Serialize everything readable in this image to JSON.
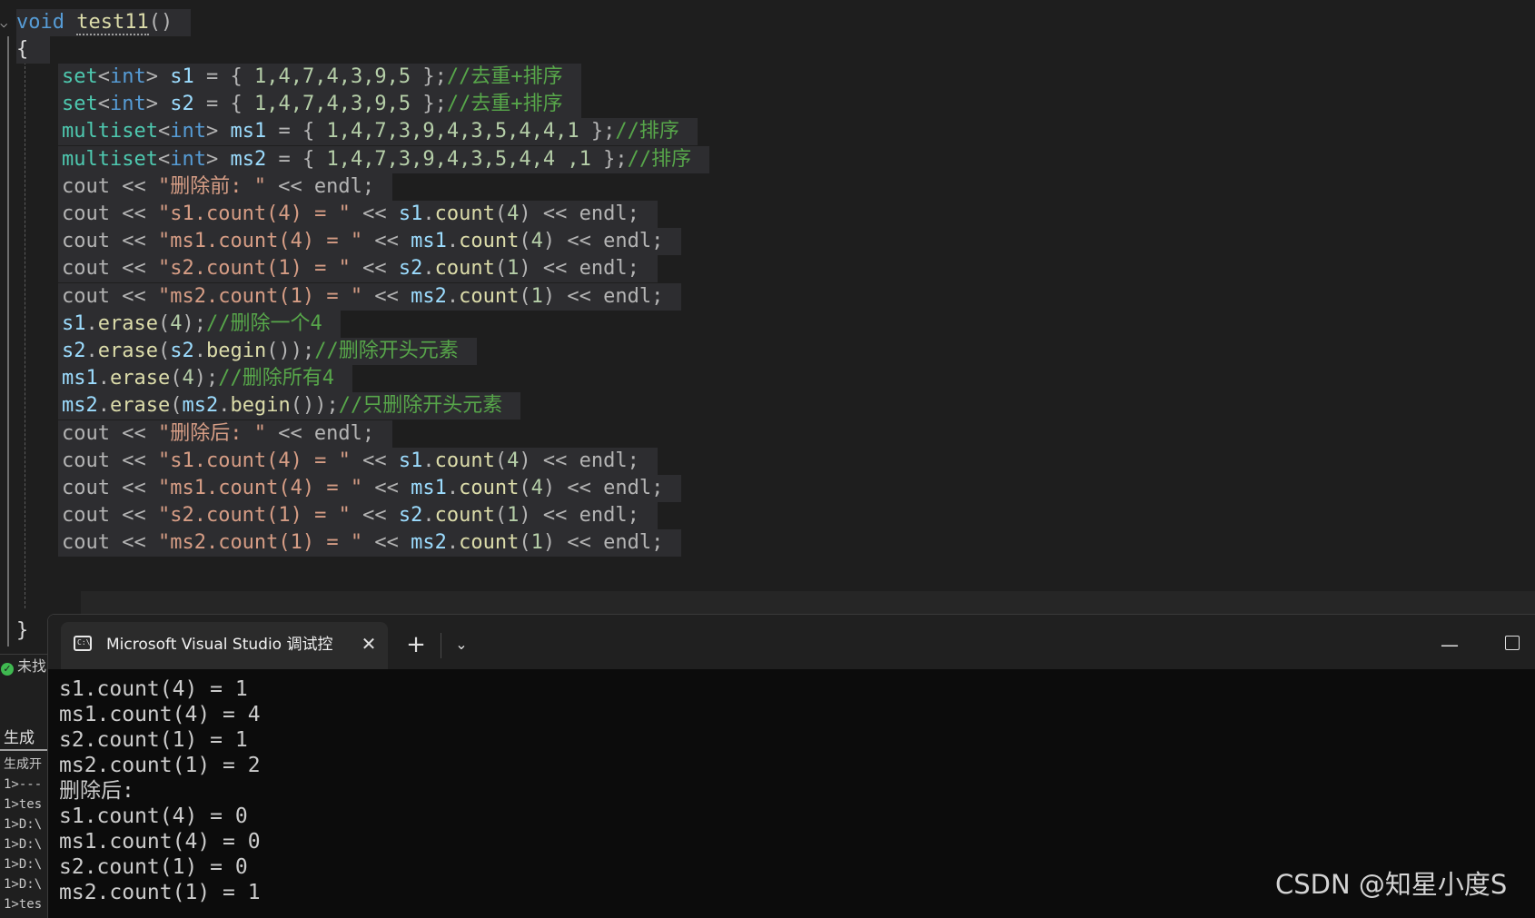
{
  "editor": {
    "signature": {
      "kw": "void",
      "name": "test11",
      "parens": "()"
    },
    "open_brace": "{",
    "close_brace": "}",
    "lines": [
      {
        "tokens": [
          [
            "type",
            "set"
          ],
          [
            "op",
            "<"
          ],
          [
            "kw",
            "int"
          ],
          [
            "op",
            "> "
          ],
          [
            "var",
            "s1"
          ],
          [
            "op",
            " = { "
          ],
          [
            "num",
            "1,4,7,4,3,9,5"
          ],
          [
            "op",
            " };"
          ],
          [
            "cm",
            "//去重+排序"
          ]
        ]
      },
      {
        "tokens": [
          [
            "type",
            "set"
          ],
          [
            "op",
            "<"
          ],
          [
            "kw",
            "int"
          ],
          [
            "op",
            "> "
          ],
          [
            "var",
            "s2"
          ],
          [
            "op",
            " = { "
          ],
          [
            "num",
            "1,4,7,4,3,9,5"
          ],
          [
            "op",
            " };"
          ],
          [
            "cm",
            "//去重+排序"
          ]
        ]
      },
      {
        "tokens": [
          [
            "type",
            "multiset"
          ],
          [
            "op",
            "<"
          ],
          [
            "kw",
            "int"
          ],
          [
            "op",
            "> "
          ],
          [
            "var",
            "ms1"
          ],
          [
            "op",
            " = { "
          ],
          [
            "num",
            "1,4,7,3,9,4,3,5,4,4,1"
          ],
          [
            "op",
            " };"
          ],
          [
            "cm",
            "//排序"
          ]
        ]
      },
      {
        "tokens": [
          [
            "type",
            "multiset"
          ],
          [
            "op",
            "<"
          ],
          [
            "kw",
            "int"
          ],
          [
            "op",
            "> "
          ],
          [
            "var",
            "ms2"
          ],
          [
            "op",
            " = { "
          ],
          [
            "num",
            "1,4,7,3,9,4,3,5,4,4 ,1"
          ],
          [
            "op",
            " };"
          ],
          [
            "cm",
            "//排序"
          ]
        ]
      },
      {
        "tokens": [
          [
            "op",
            "cout << "
          ],
          [
            "str",
            "\"删除前: \""
          ],
          [
            "op",
            " << endl;"
          ]
        ]
      },
      {
        "tokens": [
          [
            "op",
            "cout << "
          ],
          [
            "str",
            "\"s1.count(4) = \""
          ],
          [
            "op",
            " << "
          ],
          [
            "var",
            "s1"
          ],
          [
            "op",
            "."
          ],
          [
            "fn",
            "count"
          ],
          [
            "op",
            "("
          ],
          [
            "num",
            "4"
          ],
          [
            "op",
            ") << endl;"
          ]
        ]
      },
      {
        "tokens": [
          [
            "op",
            "cout << "
          ],
          [
            "str",
            "\"ms1.count(4) = \""
          ],
          [
            "op",
            " << "
          ],
          [
            "var",
            "ms1"
          ],
          [
            "op",
            "."
          ],
          [
            "fn",
            "count"
          ],
          [
            "op",
            "("
          ],
          [
            "num",
            "4"
          ],
          [
            "op",
            ") << endl;"
          ]
        ]
      },
      {
        "tokens": [
          [
            "op",
            "cout << "
          ],
          [
            "str",
            "\"s2.count(1) = \""
          ],
          [
            "op",
            " << "
          ],
          [
            "var",
            "s2"
          ],
          [
            "op",
            "."
          ],
          [
            "fn",
            "count"
          ],
          [
            "op",
            "("
          ],
          [
            "num",
            "1"
          ],
          [
            "op",
            ") << endl;"
          ]
        ]
      },
      {
        "tokens": [
          [
            "op",
            "cout << "
          ],
          [
            "str",
            "\"ms2.count(1) = \""
          ],
          [
            "op",
            " << "
          ],
          [
            "var",
            "ms2"
          ],
          [
            "op",
            "."
          ],
          [
            "fn",
            "count"
          ],
          [
            "op",
            "("
          ],
          [
            "num",
            "1"
          ],
          [
            "op",
            ") << endl;"
          ]
        ]
      },
      {
        "tokens": [
          [
            "var",
            "s1"
          ],
          [
            "op",
            "."
          ],
          [
            "fn",
            "erase"
          ],
          [
            "op",
            "("
          ],
          [
            "num",
            "4"
          ],
          [
            "op",
            ");"
          ],
          [
            "cm",
            "//删除一个4"
          ]
        ]
      },
      {
        "tokens": [
          [
            "var",
            "s2"
          ],
          [
            "op",
            "."
          ],
          [
            "fn",
            "erase"
          ],
          [
            "op",
            "("
          ],
          [
            "var",
            "s2"
          ],
          [
            "op",
            "."
          ],
          [
            "fn",
            "begin"
          ],
          [
            "op",
            "());"
          ],
          [
            "cm",
            "//删除开头元素"
          ]
        ]
      },
      {
        "tokens": [
          [
            "var",
            "ms1"
          ],
          [
            "op",
            "."
          ],
          [
            "fn",
            "erase"
          ],
          [
            "op",
            "("
          ],
          [
            "num",
            "4"
          ],
          [
            "op",
            ");"
          ],
          [
            "cm",
            "//删除所有4"
          ]
        ]
      },
      {
        "tokens": [
          [
            "var",
            "ms2"
          ],
          [
            "op",
            "."
          ],
          [
            "fn",
            "erase"
          ],
          [
            "op",
            "("
          ],
          [
            "var",
            "ms2"
          ],
          [
            "op",
            "."
          ],
          [
            "fn",
            "begin"
          ],
          [
            "op",
            "());"
          ],
          [
            "cm",
            "//只删除开头元素"
          ]
        ]
      },
      {
        "tokens": [
          [
            "op",
            "cout << "
          ],
          [
            "str",
            "\"删除后: \""
          ],
          [
            "op",
            " << endl;"
          ]
        ]
      },
      {
        "tokens": [
          [
            "op",
            "cout << "
          ],
          [
            "str",
            "\"s1.count(4) = \""
          ],
          [
            "op",
            " << "
          ],
          [
            "var",
            "s1"
          ],
          [
            "op",
            "."
          ],
          [
            "fn",
            "count"
          ],
          [
            "op",
            "("
          ],
          [
            "num",
            "4"
          ],
          [
            "op",
            ") << endl;"
          ]
        ]
      },
      {
        "tokens": [
          [
            "op",
            "cout << "
          ],
          [
            "str",
            "\"ms1.count(4) = \""
          ],
          [
            "op",
            " << "
          ],
          [
            "var",
            "ms1"
          ],
          [
            "op",
            "."
          ],
          [
            "fn",
            "count"
          ],
          [
            "op",
            "("
          ],
          [
            "num",
            "4"
          ],
          [
            "op",
            ") << endl;"
          ]
        ]
      },
      {
        "tokens": [
          [
            "op",
            "cout << "
          ],
          [
            "str",
            "\"s2.count(1) = \""
          ],
          [
            "op",
            " << "
          ],
          [
            "var",
            "s2"
          ],
          [
            "op",
            "."
          ],
          [
            "fn",
            "count"
          ],
          [
            "op",
            "("
          ],
          [
            "num",
            "1"
          ],
          [
            "op",
            ") << endl;"
          ]
        ]
      },
      {
        "tokens": [
          [
            "op",
            "cout << "
          ],
          [
            "str",
            "\"ms2.count(1) = \""
          ],
          [
            "op",
            " << "
          ],
          [
            "var",
            "ms2"
          ],
          [
            "op",
            "."
          ],
          [
            "fn",
            "count"
          ],
          [
            "op",
            "("
          ],
          [
            "num",
            "1"
          ],
          [
            "op",
            ") << endl;"
          ]
        ]
      }
    ]
  },
  "vs_panel": {
    "status_text": "未找",
    "output_tab": "生成",
    "output_lines": [
      "生成开",
      "1>---",
      "1>tes",
      "1>D:\\",
      "1>D:\\",
      "1>D:\\",
      "1>D:\\",
      "1>tes"
    ]
  },
  "console": {
    "tab_icon": "C:\\",
    "tab_title": "Microsoft Visual Studio 调试控",
    "close_glyph": "✕",
    "new_tab_glyph": "+",
    "dropdown_glyph": "⌄",
    "minimize_glyph": "—",
    "lines": [
      "s1.count(4) = 1",
      "ms1.count(4) = 4",
      "s2.count(1) = 1",
      "ms2.count(1) = 2",
      "删除后:",
      "s1.count(4) = 0",
      "ms1.count(4) = 0",
      "s2.count(1) = 0",
      "ms2.count(1) = 1"
    ]
  },
  "watermark": "CSDN @知星小度S",
  "colors": {
    "keyword": "#569cd6",
    "type": "#4ec9b0",
    "variable": "#9cdcfe",
    "function": "#dcdcaa",
    "number": "#b5cea8",
    "string": "#d69d85",
    "comment": "#57a64a",
    "editor_bg": "#1e1e1e",
    "console_bg": "#0c0c0c"
  }
}
